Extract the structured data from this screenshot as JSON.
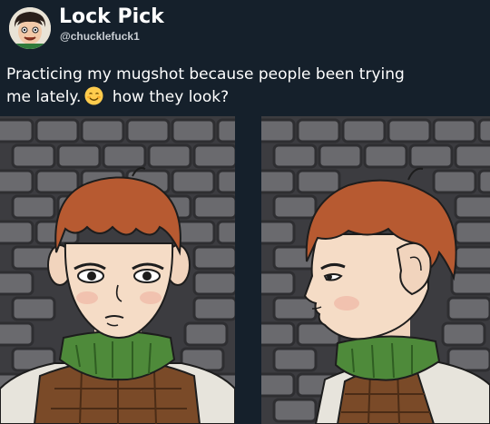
{
  "tweet": {
    "author": {
      "display_name": "Lock Pick",
      "handle": "@chucklefuck1"
    },
    "text_line1": "Practicing my mugshot because people been trying",
    "text_line2_before_emoji": "me lately.",
    "emoji": "smiling-face-emoji",
    "text_line2_after_emoji": "how they look?",
    "media": [
      {
        "name": "mugshot-front-view"
      },
      {
        "name": "mugshot-side-view"
      }
    ]
  },
  "colors": {
    "background": "#15202b",
    "text": "#ffffff",
    "handle": "#c9ced3",
    "brick_wall": "#5e5e62",
    "hair": "#b75a31",
    "scarf": "#4e8a3a",
    "vest": "#7a4a28"
  }
}
